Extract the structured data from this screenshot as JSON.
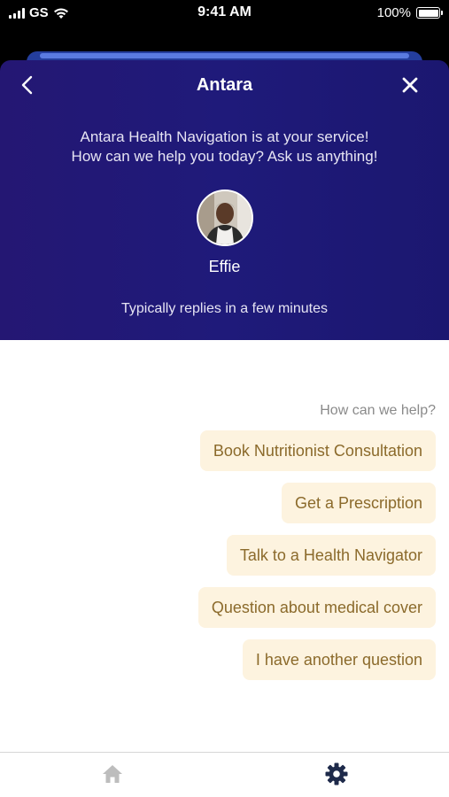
{
  "status_bar": {
    "carrier": "GS",
    "time": "9:41 AM",
    "battery": "100%",
    "battery_level": 1.0,
    "icons": [
      "signal-icon",
      "wifi-icon",
      "battery-icon"
    ]
  },
  "header": {
    "title": "Antara",
    "intro_line1": "Antara Health Navigation is at your service!",
    "intro_line2": "How can we help you today? Ask us anything!",
    "agent_name": "Effie",
    "reply_time": "Typically replies in a few minutes",
    "background_color": "#1f1a7a",
    "icons": [
      "chevron-left-icon",
      "close-icon"
    ]
  },
  "chat": {
    "prompt": "How can we help?",
    "options": [
      "Book Nutritionist Consultation",
      "Get a Prescription",
      "Talk to a Health Navigator",
      "Question about medical cover",
      "I have another question"
    ],
    "option_bg_color": "#fdf3df",
    "option_text_color": "#8b6a2b"
  },
  "tab_bar": {
    "items": [
      "home-icon",
      "gear-icon"
    ],
    "active": "gear-icon",
    "active_color": "#1e2a4a",
    "inactive_color": "#bdbdbd"
  }
}
